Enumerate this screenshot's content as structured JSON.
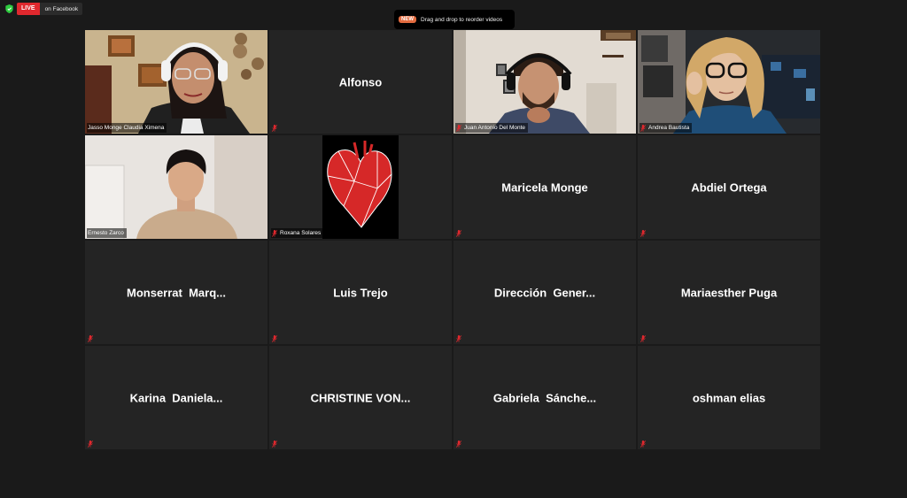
{
  "header": {
    "live_badge": "LIVE",
    "live_destination": "on Facebook",
    "notice_badge": "NEW",
    "notice_text": "Drag and drop to reorder videos"
  },
  "participants": [
    {
      "name": "Jasso Monge Claudia Ximena",
      "video": true
    },
    {
      "name": "Alfonso",
      "video": false
    },
    {
      "name": "Juan Antonio Del Monte",
      "video": true
    },
    {
      "name": "Andrea Bautista",
      "video": true
    },
    {
      "name": "Ernesto Zarco",
      "video": true
    },
    {
      "name": "Roxana Solares",
      "video": true
    },
    {
      "name": "Maricela Monge",
      "video": false
    },
    {
      "name": "Abdiel Ortega",
      "video": false
    },
    {
      "name": "Monserrat  Marq...",
      "video": false
    },
    {
      "name": "Luis Trejo",
      "video": false
    },
    {
      "name": "Dirección  Gener...",
      "video": false
    },
    {
      "name": "Mariaesther Puga",
      "video": false
    },
    {
      "name": "Karina  Daniela...",
      "video": false
    },
    {
      "name": "CHRISTINE VON...",
      "video": false
    },
    {
      "name": "Gabriela  Sánche...",
      "video": false
    },
    {
      "name": "oshman elias",
      "video": false
    }
  ],
  "colors": {
    "background": "#1a1a1a",
    "tile": "#242424",
    "active_speaker": "#c6e03a",
    "live": "#e0282e",
    "muted_mic": "#e0282e"
  }
}
